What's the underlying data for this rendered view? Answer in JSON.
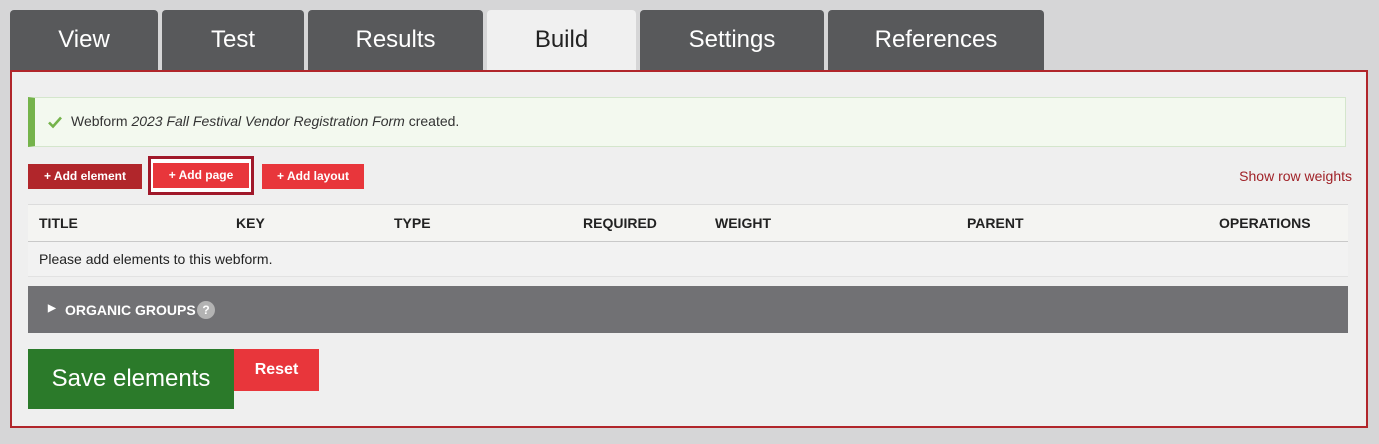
{
  "tabs": [
    {
      "label": "View"
    },
    {
      "label": "Test"
    },
    {
      "label": "Results"
    },
    {
      "label": "Build",
      "active": true
    },
    {
      "label": "Settings"
    },
    {
      "label": "References"
    }
  ],
  "status": {
    "prefix": "Webform ",
    "form_name": "2023 Fall Festival Vendor Registration Form",
    "suffix": " created."
  },
  "actions": {
    "add_element": "+ Add element",
    "add_page": "+ Add page",
    "add_layout": "+ Add layout",
    "show_row_weights": "Show row weights"
  },
  "table": {
    "columns": [
      "TITLE",
      "KEY",
      "TYPE",
      "REQUIRED",
      "WEIGHT",
      "PARENT",
      "OPERATIONS"
    ],
    "empty_message": "Please add elements to this webform."
  },
  "organic_groups": {
    "label": "ORGANIC GROUPS",
    "help": "?"
  },
  "buttons": {
    "save": "Save elements",
    "reset": "Reset"
  },
  "colors": {
    "tab_bg": "#58595b",
    "tab_active_bg": "#f0f0f0",
    "panel_border": "#b1262b",
    "button_dark_red": "#b1262b",
    "button_red": "#e8363b",
    "status_green": "#75b34b",
    "save_green": "#2b7a2a",
    "groups_bg": "#717174"
  }
}
